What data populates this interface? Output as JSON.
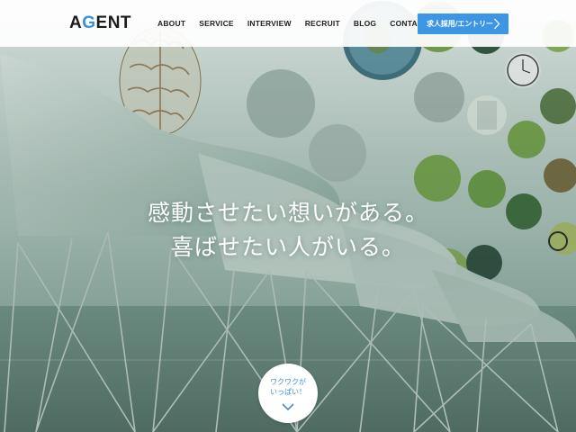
{
  "header": {
    "logo": {
      "text_a": "A",
      "text_g": "G",
      "text_rest": "ENT"
    },
    "nav": [
      {
        "label": "ABOUT"
      },
      {
        "label": "SERVICE"
      },
      {
        "label": "INTERVIEW"
      },
      {
        "label": "RECRUIT"
      },
      {
        "label": "BLOG"
      },
      {
        "label": "CONTACT"
      }
    ],
    "entry_button": {
      "label": "求人採用/エントリー",
      "icon": "chevron-right-icon"
    }
  },
  "hero": {
    "catch_line1": "感動させたい想いがある。",
    "catch_line2": "喜ばせたい人がいる。"
  },
  "scroll_badge": {
    "line1": "ワクワクが",
    "line2": "いっぱい！",
    "icon": "chevron-down-icon"
  },
  "colors": {
    "accent": "#3a8fe0",
    "button": "#3d95e6",
    "header_bg": "#ffffff",
    "scene_green": "#6f8f84"
  }
}
